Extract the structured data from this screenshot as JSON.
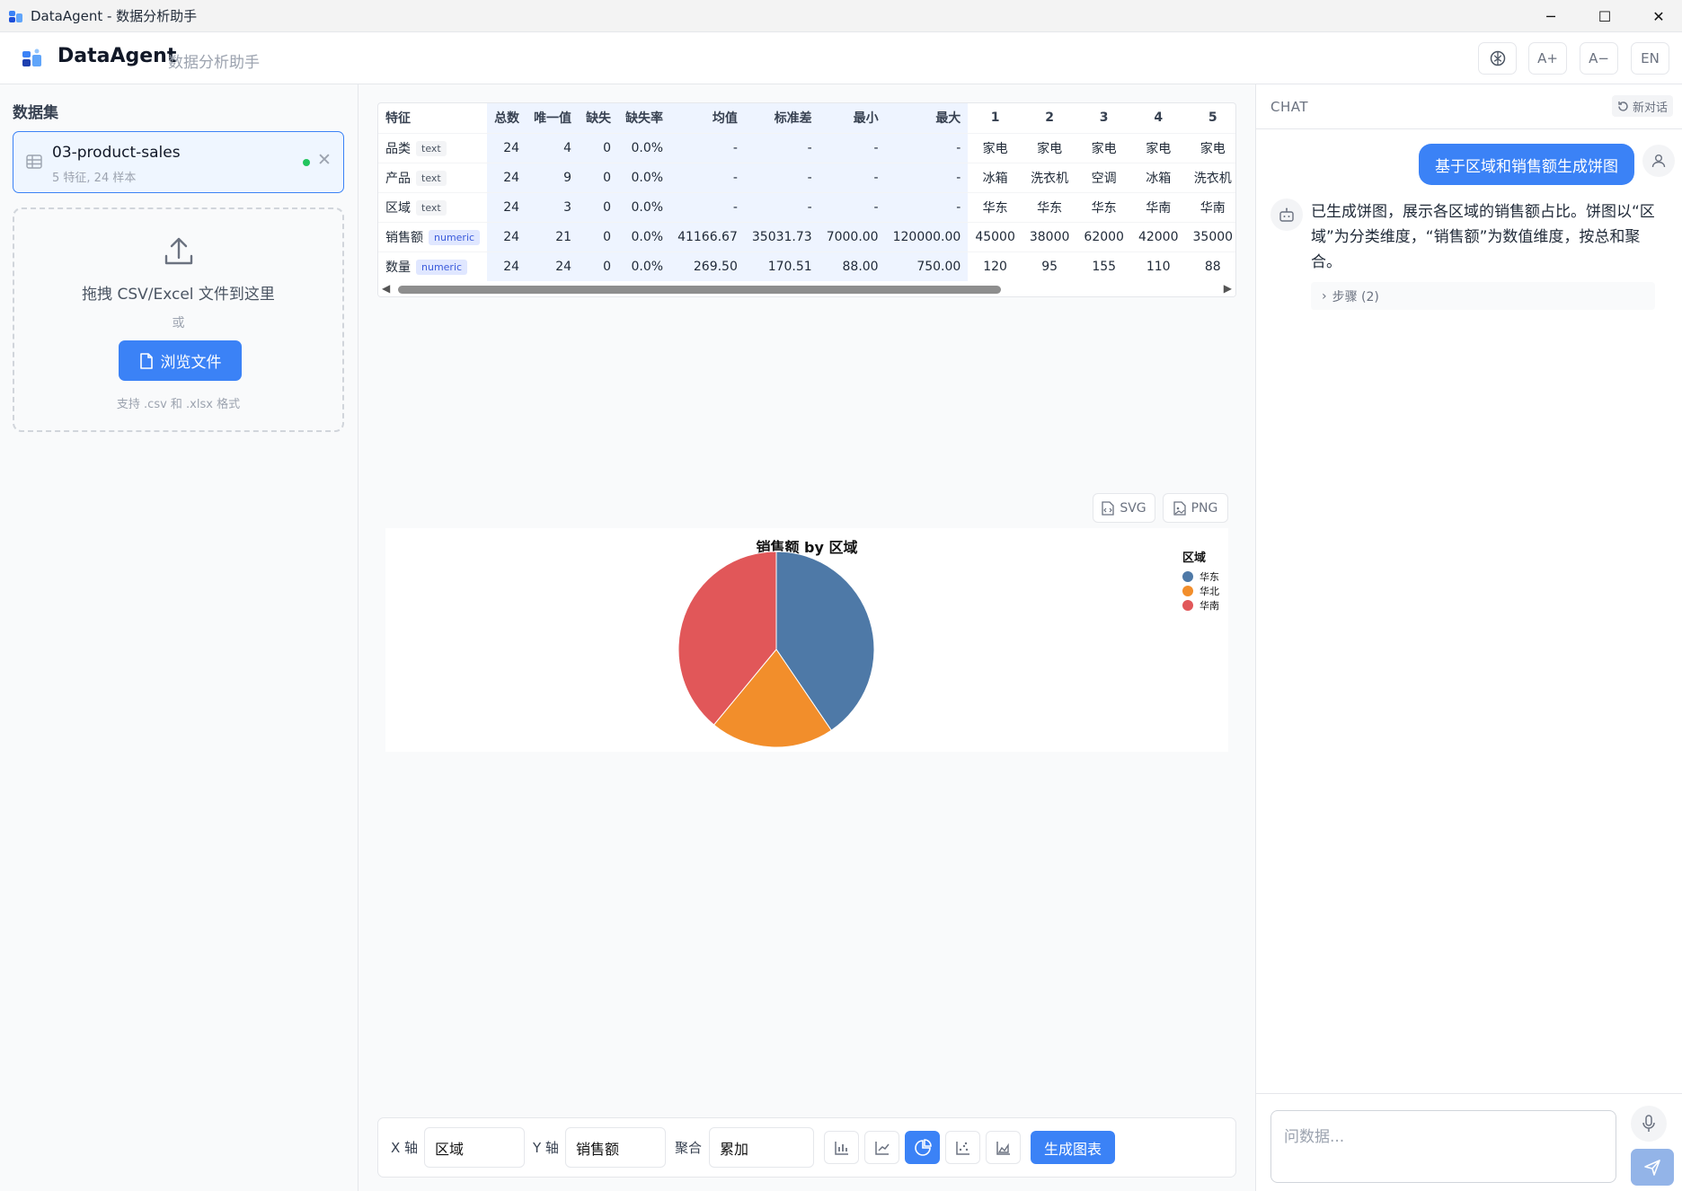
{
  "window": {
    "title": "DataAgent - 数据分析助手",
    "controls": {
      "minimize": "─",
      "maximize": "☐",
      "close": "✕"
    }
  },
  "header": {
    "brand": "DataAgent",
    "subtitle": "数据分析助手",
    "buttons": {
      "font_up": "A+",
      "font_down": "A−",
      "lang": "EN"
    }
  },
  "sidebar": {
    "title": "数据集",
    "dataset": {
      "name": "03-product-sales",
      "meta": "5 特征, 24 样本",
      "status_color": "#22c55e"
    },
    "dropzone": {
      "text": "拖拽 CSV/Excel 文件到这里",
      "or": "或",
      "button": "浏览文件",
      "hint": "支持 .csv 和 .xlsx 格式"
    }
  },
  "table": {
    "headers": [
      "特征",
      "总数",
      "唯一值",
      "缺失",
      "缺失率",
      "均值",
      "标准差",
      "最小",
      "最大",
      "1",
      "2",
      "3",
      "4",
      "5"
    ],
    "rows": [
      {
        "feature": "品类",
        "type": "text",
        "count": "24",
        "unique": "4",
        "missing": "0",
        "missing_rate": "0.0%",
        "mean": "-",
        "std": "-",
        "min": "-",
        "max": "-",
        "samples": [
          "家电",
          "家电",
          "家电",
          "家电",
          "家电"
        ]
      },
      {
        "feature": "产品",
        "type": "text",
        "count": "24",
        "unique": "9",
        "missing": "0",
        "missing_rate": "0.0%",
        "mean": "-",
        "std": "-",
        "min": "-",
        "max": "-",
        "samples": [
          "冰箱",
          "洗衣机",
          "空调",
          "冰箱",
          "洗衣机"
        ]
      },
      {
        "feature": "区域",
        "type": "text",
        "count": "24",
        "unique": "3",
        "missing": "0",
        "missing_rate": "0.0%",
        "mean": "-",
        "std": "-",
        "min": "-",
        "max": "-",
        "samples": [
          "华东",
          "华东",
          "华东",
          "华南",
          "华南"
        ]
      },
      {
        "feature": "销售额",
        "type": "numeric",
        "count": "24",
        "unique": "21",
        "missing": "0",
        "missing_rate": "0.0%",
        "mean": "41166.67",
        "std": "35031.73",
        "min": "7000.00",
        "max": "120000.00",
        "samples": [
          "45000",
          "38000",
          "62000",
          "42000",
          "35000"
        ]
      },
      {
        "feature": "数量",
        "type": "numeric",
        "count": "24",
        "unique": "24",
        "missing": "0",
        "missing_rate": "0.0%",
        "mean": "269.50",
        "std": "170.51",
        "min": "88.00",
        "max": "750.00",
        "samples": [
          "120",
          "95",
          "155",
          "110",
          "88"
        ]
      }
    ]
  },
  "export": {
    "svg": "SVG",
    "png": "PNG"
  },
  "chart_data": {
    "type": "pie",
    "title": "销售额 by 区域",
    "legend_title": "区域",
    "legend_position": "top-right",
    "categories": [
      "华东",
      "华北",
      "华南"
    ],
    "values": [
      40.5,
      20.5,
      39.0
    ],
    "colors": [
      "#4e79a7",
      "#f28e2b",
      "#e15759"
    ]
  },
  "controls": {
    "x_label": "X 轴",
    "x_value": "区域",
    "y_label": "Y 轴",
    "y_value": "销售额",
    "agg_label": "聚合",
    "agg_value": "累加",
    "chart_types": [
      "bar-chart-icon",
      "line-chart-icon",
      "pie-chart-icon",
      "scatter-chart-icon",
      "area-chart-icon"
    ],
    "active_chart_type": "pie-chart-icon",
    "generate": "生成图表"
  },
  "chat": {
    "title": "CHAT",
    "new_chat": "新对话",
    "messages": [
      {
        "role": "user",
        "text": "基于区域和销售额生成饼图"
      },
      {
        "role": "assistant",
        "text": "已生成饼图，展示各区域的销售额占比。饼图以“区域”为分类维度，“销售额”为数值维度，按总和聚合。",
        "steps": "步骤 (2)"
      }
    ],
    "input_placeholder": "问数据..."
  },
  "colors": {
    "accent": "#3b82f6",
    "send_disabled": "#93b4e8"
  }
}
